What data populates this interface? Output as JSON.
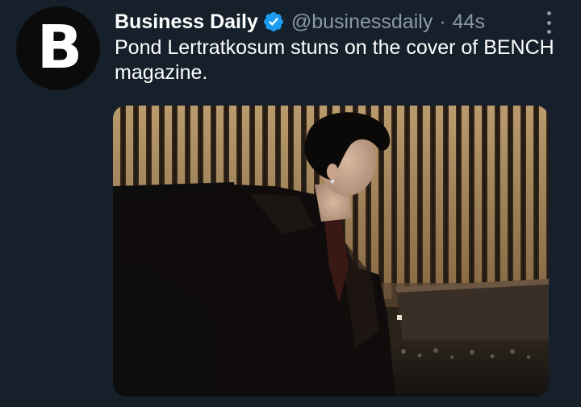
{
  "tweet": {
    "avatar": {
      "letter": "B",
      "icon": "business-daily-logo"
    },
    "display_name": "Business Daily",
    "verified_icon": "verified-badge-icon",
    "handle": "@businessdaily",
    "separator": "·",
    "time": "44s",
    "more_icon": "more-vertical-icon",
    "text": "Pond Lertratkosum stuns on the cover of BENCH magazine.",
    "media": {
      "kind": "photo"
    }
  },
  "colors": {
    "background": "#15202b",
    "text_primary": "#ffffff",
    "text_secondary": "#8b98a5",
    "verified": "#1d9bf0"
  }
}
